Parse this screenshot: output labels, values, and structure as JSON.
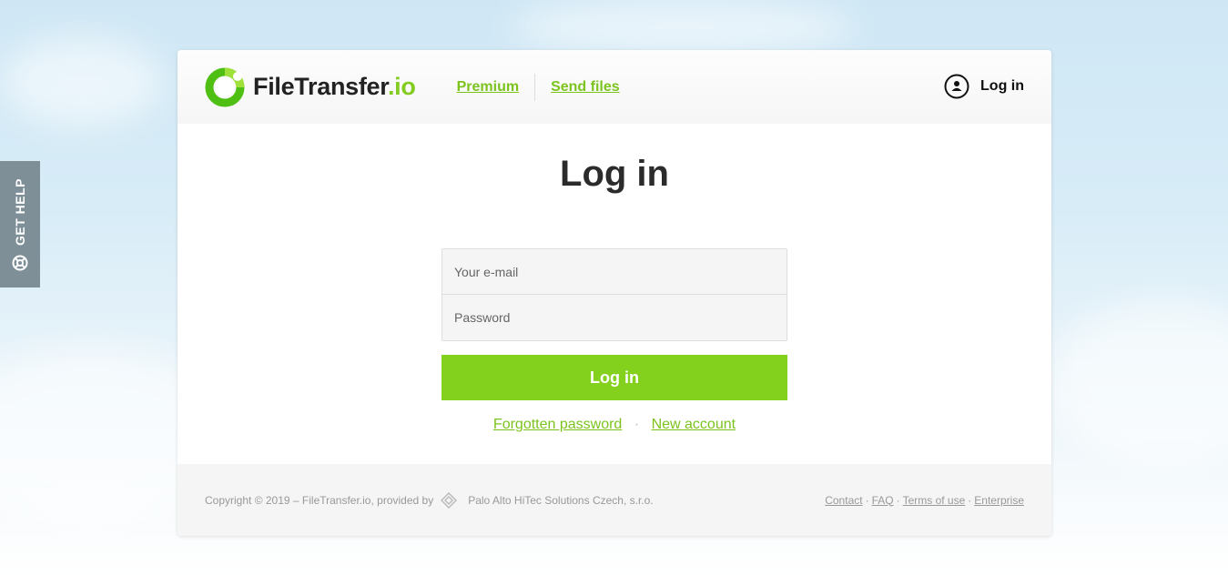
{
  "help_tab": {
    "label": "GET HELP"
  },
  "header": {
    "logo_name": "FileTransfer",
    "logo_tld": ".io",
    "nav": [
      {
        "label": "Premium"
      },
      {
        "label": "Send files"
      }
    ],
    "login_label": "Log in"
  },
  "main": {
    "title": "Log in",
    "email_placeholder": "Your e-mail",
    "password_placeholder": "Password",
    "submit_label": "Log in",
    "forgot_label": "Forgotten password",
    "link_separator": "·",
    "new_account_label": "New account"
  },
  "footer": {
    "copyright": "Copyright © 2019 – FileTransfer.io, provided by",
    "provider": "Palo Alto HiTec Solutions Czech, s.r.o.",
    "links": [
      {
        "label": "Contact"
      },
      {
        "label": "FAQ"
      },
      {
        "label": "Terms of use"
      },
      {
        "label": "Enterprise"
      }
    ],
    "separator": "·"
  },
  "icons": {
    "help": "lifebuoy-icon",
    "logo": "logo-ring-icon",
    "user": "user-circle-icon",
    "provider": "palo-alto-diamond-icon"
  },
  "colors": {
    "accent": "#84d11d",
    "link": "#7cc31e",
    "help_tab": "#7e8f98"
  }
}
